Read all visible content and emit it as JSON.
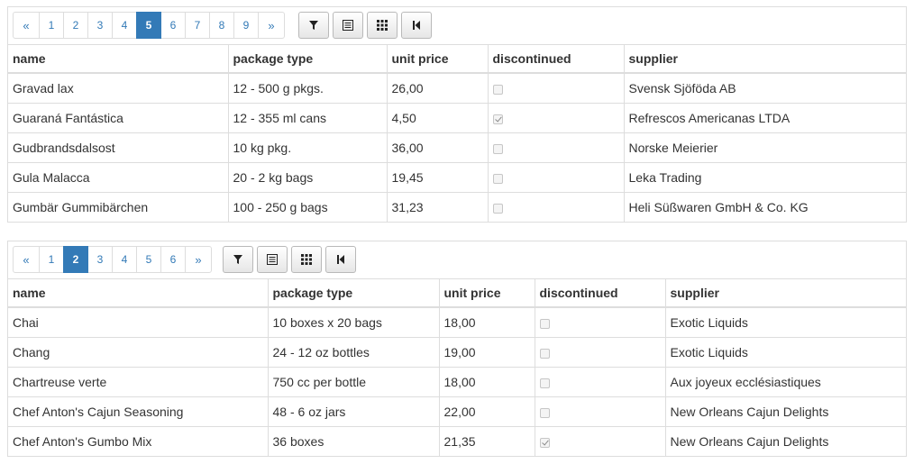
{
  "pager_icons": {
    "filter": "filter-icon",
    "columns": "column-chooser-icon",
    "grid": "grid-icon",
    "first": "first-page-icon"
  },
  "colors": {
    "accent": "#337ab7",
    "border": "#dddddd",
    "text": "#333333"
  },
  "grids": [
    {
      "pager": {
        "prev": "«",
        "next": "»",
        "pages": [
          "1",
          "2",
          "3",
          "4",
          "5",
          "6",
          "7",
          "8",
          "9"
        ],
        "active_page": "5"
      },
      "columns": [
        "name",
        "package type",
        "unit price",
        "discontinued",
        "supplier"
      ],
      "rows": [
        {
          "name": "Gravad lax",
          "package_type": "12 - 500 g pkgs.",
          "unit_price": "26,00",
          "discontinued": false,
          "supplier": "Svensk Sjöföda AB"
        },
        {
          "name": "Guaraná Fantástica",
          "package_type": "12 - 355 ml cans",
          "unit_price": "4,50",
          "discontinued": true,
          "supplier": "Refrescos Americanas LTDA"
        },
        {
          "name": "Gudbrandsdalsost",
          "package_type": "10 kg pkg.",
          "unit_price": "36,00",
          "discontinued": false,
          "supplier": "Norske Meierier"
        },
        {
          "name": "Gula Malacca",
          "package_type": "20 - 2 kg bags",
          "unit_price": "19,45",
          "discontinued": false,
          "supplier": "Leka Trading"
        },
        {
          "name": "Gumbär Gummibärchen",
          "package_type": "100 - 250 g bags",
          "unit_price": "31,23",
          "discontinued": false,
          "supplier": "Heli Süßwaren GmbH & Co. KG"
        }
      ]
    },
    {
      "pager": {
        "prev": "«",
        "next": "»",
        "pages": [
          "1",
          "2",
          "3",
          "4",
          "5",
          "6"
        ],
        "active_page": "2"
      },
      "columns": [
        "name",
        "package type",
        "unit price",
        "discontinued",
        "supplier"
      ],
      "rows": [
        {
          "name": "Chai",
          "package_type": "10 boxes x 20 bags",
          "unit_price": "18,00",
          "discontinued": false,
          "supplier": "Exotic Liquids"
        },
        {
          "name": "Chang",
          "package_type": "24 - 12 oz bottles",
          "unit_price": "19,00",
          "discontinued": false,
          "supplier": "Exotic Liquids"
        },
        {
          "name": "Chartreuse verte",
          "package_type": "750 cc per bottle",
          "unit_price": "18,00",
          "discontinued": false,
          "supplier": "Aux joyeux ecclésiastiques"
        },
        {
          "name": "Chef Anton's Cajun Seasoning",
          "package_type": "48 - 6 oz jars",
          "unit_price": "22,00",
          "discontinued": false,
          "supplier": "New Orleans Cajun Delights"
        },
        {
          "name": "Chef Anton's Gumbo Mix",
          "package_type": "36 boxes",
          "unit_price": "21,35",
          "discontinued": true,
          "supplier": "New Orleans Cajun Delights"
        }
      ]
    }
  ]
}
